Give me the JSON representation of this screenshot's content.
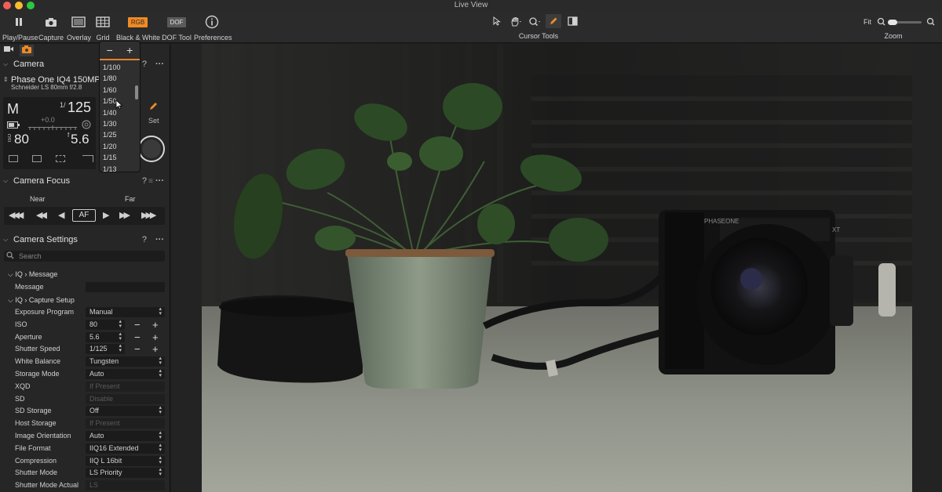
{
  "window": {
    "title": "Live View"
  },
  "toolbar": {
    "tools": [
      {
        "label": "Play/Pause",
        "icon": "pause-icon"
      },
      {
        "label": "Capture",
        "icon": "camera-icon"
      },
      {
        "label": "Overlay",
        "icon": "overlay-icon"
      },
      {
        "label": "Grid",
        "icon": "grid-icon"
      },
      {
        "label": "Black & White",
        "icon": "rgb-icon",
        "badge": "RGB"
      },
      {
        "label": "DOF Tool",
        "icon": "dof-icon",
        "badge": "DOF"
      },
      {
        "label": "Preferences",
        "icon": "info-icon"
      }
    ],
    "cursor_tools_label": "Cursor Tools",
    "zoom_fit": "Fit",
    "zoom_label": "Zoom",
    "accent": "#f08a24"
  },
  "camera": {
    "section_title": "Camera",
    "name": "Phase One IQ4 150MP",
    "lens": "Schneider LS 80mm f/2.8",
    "mode": "M",
    "shutter_prefix": "1/",
    "shutter": "125",
    "ev": "+0.0",
    "iso_label": "ISO",
    "iso": "80",
    "aperture_prefix": "f",
    "aperture": "5.6",
    "set_label": "Set"
  },
  "shutter_dropdown": {
    "minus": "−",
    "plus": "+",
    "options": [
      "1/100",
      "1/80",
      "1/60",
      "1/50",
      "1/40",
      "1/30",
      "1/25",
      "1/20",
      "1/15",
      "1/13"
    ]
  },
  "focus": {
    "section_title": "Camera Focus",
    "near": "Near",
    "far": "Far",
    "af": "AF"
  },
  "settings": {
    "section_title": "Camera Settings",
    "search_placeholder": "Search",
    "group_message": "IQ › Message",
    "group_capture": "IQ › Capture Setup",
    "message_label": "Message",
    "rows": [
      {
        "label": "Exposure Program",
        "value": "Manual"
      },
      {
        "label": "ISO",
        "value": "80"
      },
      {
        "label": "Aperture",
        "value": "5.6"
      },
      {
        "label": "Shutter Speed",
        "value": "1/125"
      },
      {
        "label": "White Balance",
        "value": "Tungsten"
      },
      {
        "label": "Storage Mode",
        "value": "Auto"
      },
      {
        "label": "XQD",
        "value": "If Present"
      },
      {
        "label": "SD",
        "value": "Disable"
      },
      {
        "label": "SD Storage",
        "value": "Off"
      },
      {
        "label": "Host Storage",
        "value": "If Present"
      },
      {
        "label": "Image Orientation",
        "value": "Auto"
      },
      {
        "label": "File Format",
        "value": "IIQ16 Extended"
      },
      {
        "label": "Compression",
        "value": "IIQ L 16bit"
      },
      {
        "label": "Shutter Mode",
        "value": "LS Priority"
      },
      {
        "label": "Shutter Mode Actual",
        "value": "LS"
      }
    ]
  },
  "help": "?",
  "more": "···"
}
